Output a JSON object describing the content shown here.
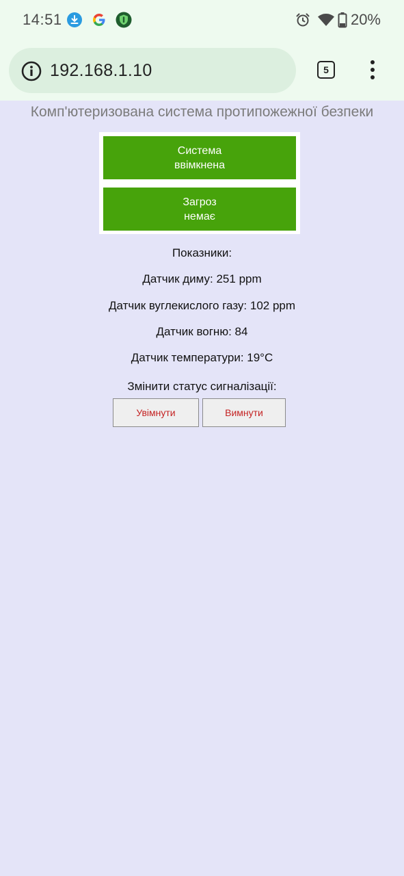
{
  "status_bar": {
    "time": "14:51",
    "battery": "20%",
    "icons": [
      "download-icon",
      "google-icon",
      "vpn-shield-icon",
      "alarm-icon",
      "wifi-icon",
      "battery-icon"
    ]
  },
  "browser": {
    "url": "192.168.1.10",
    "tab_count": "5"
  },
  "page": {
    "title": "Комп'ютеризована система протипожежної безпеки",
    "system_status_line1": "Система",
    "system_status_line2": "ввімкнена",
    "threat_status_line1": "Загроз",
    "threat_status_line2": "немає",
    "status_color": "#47a30b",
    "indicators_heading": "Показники:",
    "smoke_sensor": "Датчик диму: 251 ppm",
    "co2_sensor": "Датчик вуглекислого газу: 102 ppm",
    "fire_sensor": "Датчик вогню: 84",
    "temperature_sensor": "Датчик температури: 19°C",
    "change_alarm_label": "Змінити статус сигналізації:",
    "enable_button": "Увімнути",
    "disable_button": "Вимнути"
  }
}
